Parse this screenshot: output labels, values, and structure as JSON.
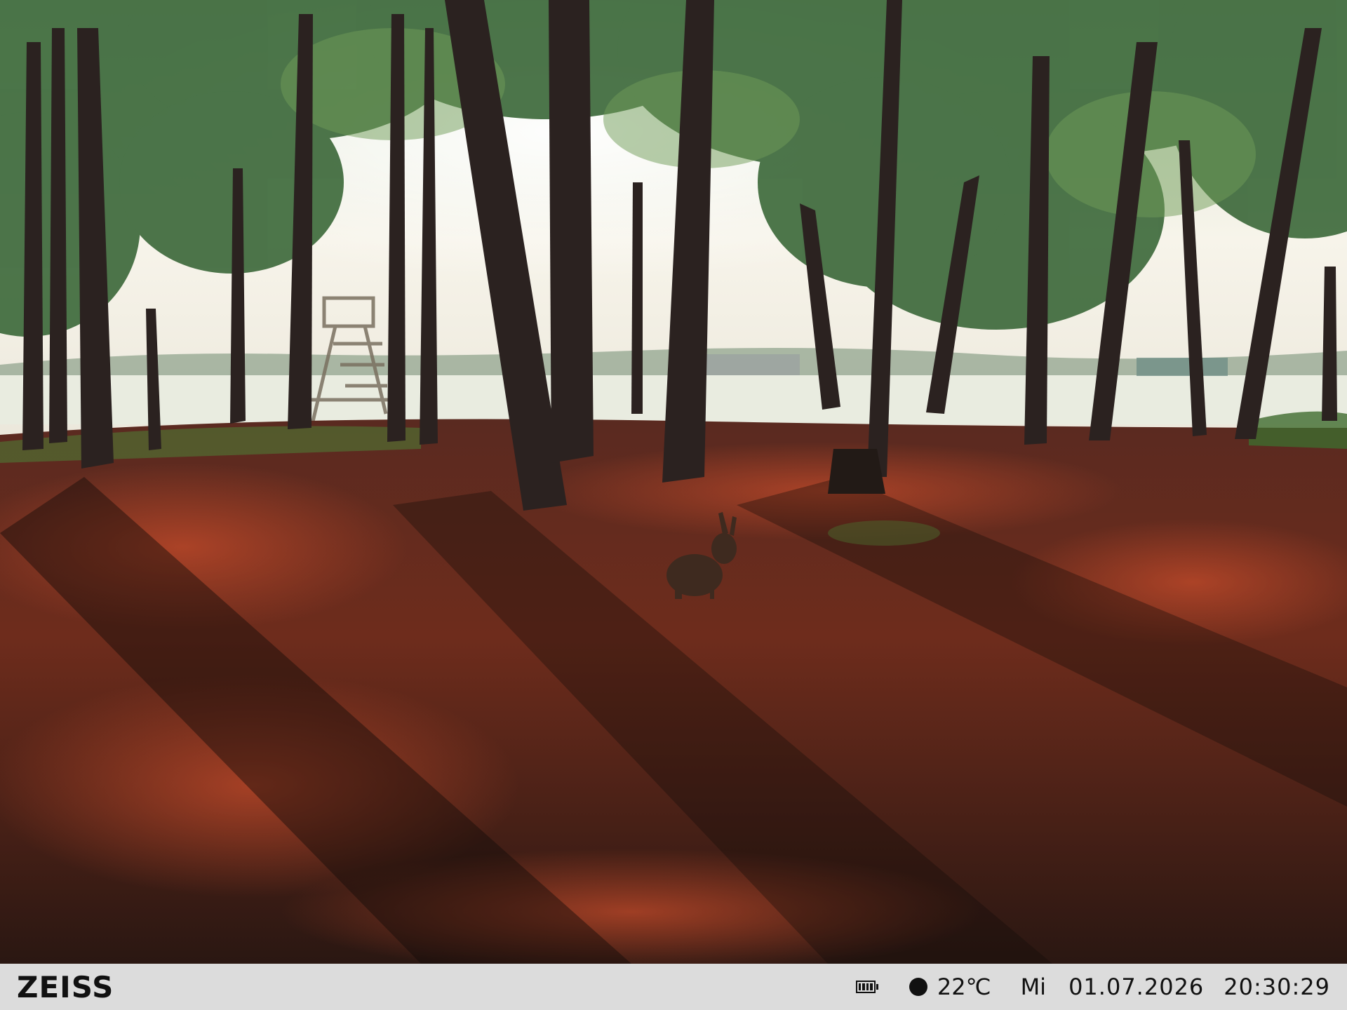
{
  "camera": {
    "brand": "ZEISS",
    "temperature": "22℃",
    "weekday": "Mi",
    "date": "01.07.2026",
    "time": "20:30:29"
  },
  "icons": {
    "battery": "battery-icon",
    "moon_phase": "moon-icon"
  },
  "colors": {
    "info_bar_bg": "#dcdcdc",
    "info_bar_text": "#111111",
    "sky": "#f4f2ea",
    "foliage": "#3f6a3a",
    "forest_floor": "#6b2a1c"
  }
}
